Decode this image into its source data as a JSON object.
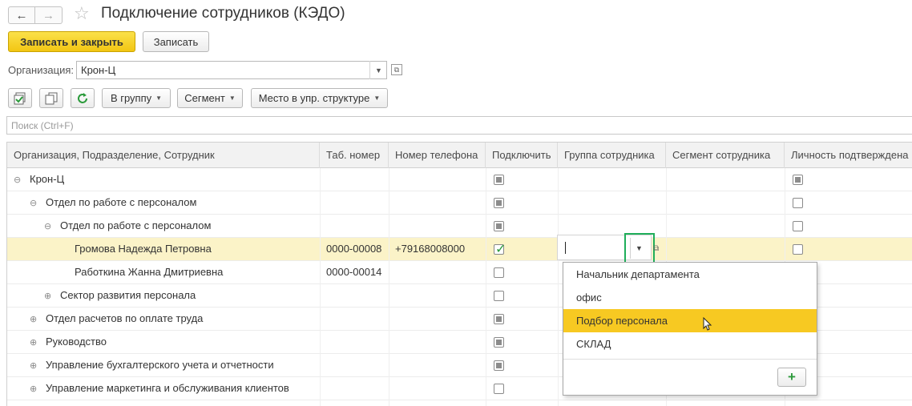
{
  "window": {
    "title": "Подключение сотрудников (КЭДО)"
  },
  "toolbar": {
    "save_close": "Записать и закрыть",
    "save": "Записать",
    "group_btn": "В группу",
    "segment_btn": "Сегмент",
    "place_btn": "Место в упр. структуре"
  },
  "org": {
    "label": "Организация:",
    "value": "Крон-Ц"
  },
  "search": {
    "placeholder": "Поиск (Ctrl+F)"
  },
  "table": {
    "columns": [
      "Организация, Подразделение, Сотрудник",
      "Таб. номер",
      "Номер телефона",
      "Подключить",
      "Группа сотрудника",
      "Сегмент сотрудника",
      "Личность подтверждена"
    ],
    "rows": [
      {
        "name": "Крон-Ц",
        "toggle": "⊖",
        "tab": "",
        "phone": "",
        "connect": "ind",
        "identity": "ind"
      },
      {
        "name": "Отдел по работе с персоналом",
        "toggle": "⊖",
        "tab": "",
        "phone": "",
        "connect": "ind",
        "identity": "empty"
      },
      {
        "name": "Отдел по работе с персоналом",
        "toggle": "⊖",
        "tab": "",
        "phone": "",
        "connect": "ind",
        "identity": "empty"
      },
      {
        "name": "Громова Надежда Петровна",
        "toggle": "",
        "tab": "0000-00008",
        "phone": "+79168008000",
        "connect": "checked",
        "identity": "empty"
      },
      {
        "name": "Работкина Жанна Дмитриевна",
        "toggle": "",
        "tab": "0000-00014",
        "phone": "",
        "connect": "empty",
        "identity": ""
      },
      {
        "name": "Сектор развития персонала",
        "toggle": "⊕",
        "tab": "",
        "phone": "",
        "connect": "empty",
        "identity": ""
      },
      {
        "name": "Отдел расчетов по оплате труда",
        "toggle": "⊕",
        "tab": "",
        "phone": "",
        "connect": "ind",
        "identity": ""
      },
      {
        "name": "Руководство",
        "toggle": "⊕",
        "tab": "",
        "phone": "",
        "connect": "ind",
        "identity": ""
      },
      {
        "name": "Управление бухгалтерского учета и отчетности",
        "toggle": "⊕",
        "tab": "",
        "phone": "",
        "connect": "ind",
        "identity": ""
      },
      {
        "name": "Управление маркетинга и обслуживания клиентов",
        "toggle": "⊕",
        "tab": "",
        "phone": "",
        "connect": "empty",
        "identity": ""
      }
    ]
  },
  "dropdown": {
    "items": [
      "Начальник департамента",
      "офис",
      "Подбор персонала",
      "СКЛАД"
    ],
    "highlighted": 2
  },
  "colors": {
    "primary": "#f2c613",
    "highlight": "#f7c922",
    "selected_row": "#fbf3c8",
    "focus": "#1fae5a"
  },
  "icons": [
    "back-arrow-icon",
    "forward-arrow-icon",
    "star-icon",
    "check-all-icon",
    "copy-icon",
    "refresh-icon",
    "chevron-down-icon",
    "open-icon",
    "plus-icon",
    "mouse-cursor-icon"
  ]
}
